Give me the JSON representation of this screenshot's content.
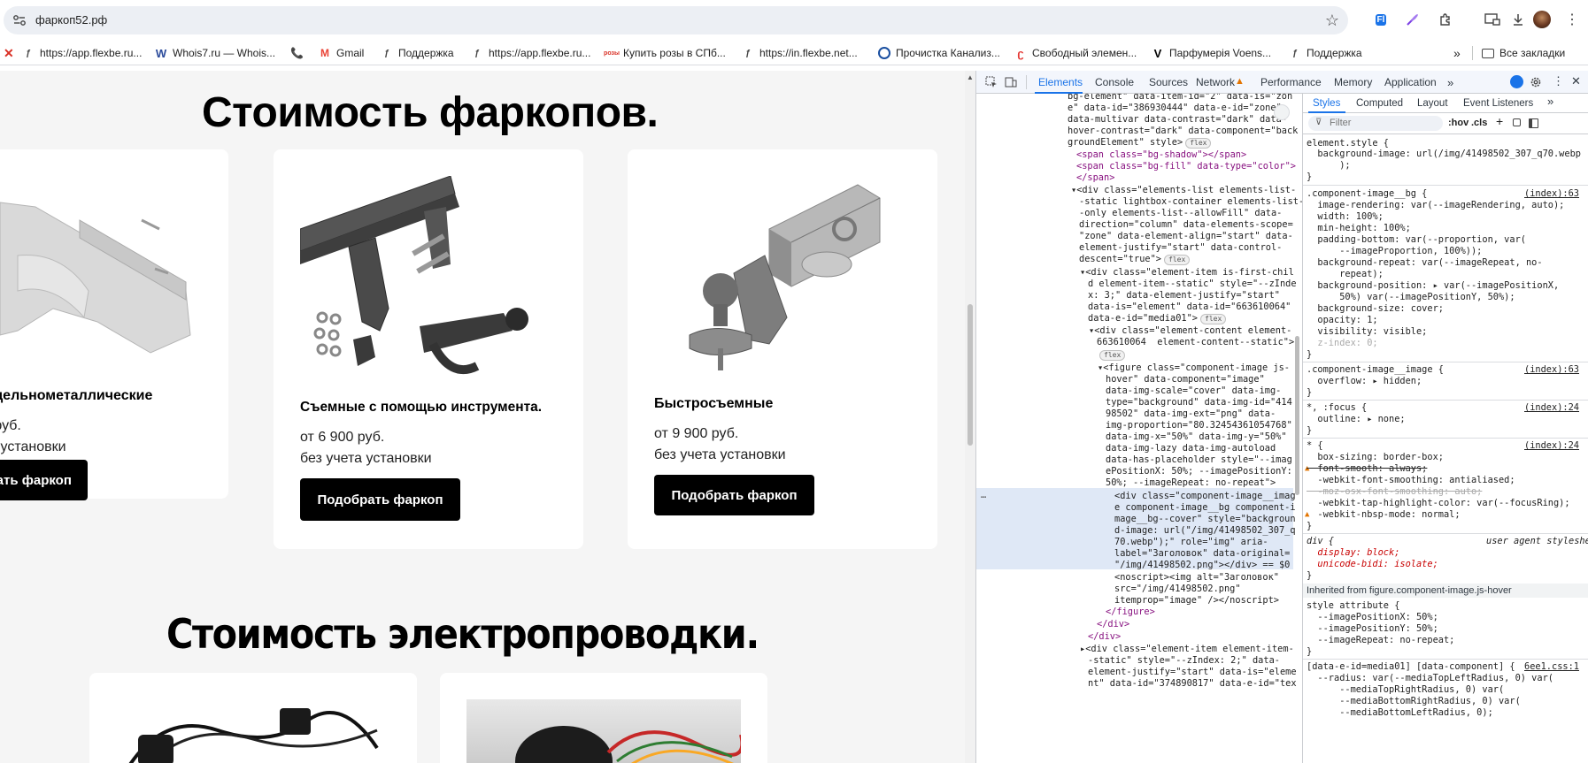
{
  "browser": {
    "url": "фаркоп52.рф",
    "bookmarks": [
      "https://app.flexbe.ru...",
      "Whois7.ru — Whois...",
      "Gmail",
      "Поддержка",
      "https://app.flexbe.ru...",
      "Купить розы в СПб...",
      "https://in.flexbe.net...",
      "Прочистка Канализ...",
      "Свободный элемен...",
      "Парфумерія Voens...",
      "Поддержка"
    ],
    "all_bookmarks": "Все закладки",
    "more": "»"
  },
  "page": {
    "heading1": "Стоимость фаркопов.",
    "heading2": "Стоимость электропроводки.",
    "cards": [
      {
        "title": "е цельнометаллические",
        "price": "о руб.",
        "note": "та установки",
        "button": "обрать фаркоп"
      },
      {
        "title": "Съемные с помощью инструмента.",
        "price": "от 6 900 руб.",
        "note": "без учета установки",
        "button": "Подобрать фаркоп"
      },
      {
        "title": "Быстросъемные",
        "price": "от 9 900 руб.",
        "note": "без учета установки",
        "button": "Подобрать фаркоп"
      }
    ]
  },
  "devtools": {
    "tabs": [
      "Elements",
      "Console",
      "Sources",
      "Network",
      "Performance",
      "Memory",
      "Application"
    ],
    "styles_tabs": [
      "Styles",
      "Computed",
      "Layout",
      "Event Listeners"
    ],
    "filter_placeholder": "Filter",
    "filter_buttons": [
      ":hov",
      ".cls"
    ],
    "elements_lines": [
      "bg-element\" data-item-id=\"2\" data-is=\"zon",
      "e\" data-id=\"386930444\" data-e-id=\"zone\"",
      "data-multivar data-contrast=\"dark\" data-",
      "hover-contrast=\"dark\" data-component=\"back",
      "groundElement\" style>",
      "<span class=\"bg-shadow\"></span>",
      "<span class=\"bg-fill\" data-type=\"color\">",
      "</span>",
      "▾<div class=\"elements-list elements-list-",
      "-static lightbox-container elements-list-",
      "-only elements-list--allowFill\" data-",
      "direction=\"column\" data-elements-scope=",
      "\"zone\" data-element-align=\"start\" data-",
      "element-justify=\"start\" data-control-",
      "descent=\"true\">",
      "▾<div class=\"element-item is-first-chil",
      "d element-item--static\" style=\"--zInde",
      "x: 3;\" data-element-justify=\"start\"",
      "data-is=\"element\" data-id=\"663610064\"",
      "data-e-id=\"media01\">",
      "▾<div class=\"element-content element-",
      "663610064  element-content--static\">",
      "",
      "▾<figure class=\"component-image js-",
      "hover\" data-component=\"image\"",
      "data-img-scale=\"cover\" data-img-",
      "type=\"background\" data-img-id=\"414",
      "98502\" data-img-ext=\"png\" data-",
      "img-proportion=\"80.32454361054768\"",
      "data-img-x=\"50%\" data-img-y=\"50%\"",
      "data-img-lazy data-img-autoload",
      "data-has-placeholder style=\"--imag",
      "ePositionX: 50%; --imagePositionY:",
      "50%; --imageRepeat: no-repeat\">",
      "<div class=\"component-image__imag",
      "e component-image__bg component-i",
      "mage__bg--cover\" style=\"backgroun",
      "d-image: url(\"/img/41498502_307_q",
      "70.webp\");\" role=\"img\" aria-",
      "label=\"Заголовок\" data-original=",
      "\"/img/41498502.png\"></div> == $0",
      "<noscript><img alt=\"Заголовок\"",
      "src=\"/img/41498502.png\"",
      "itemprop=\"image\" /></noscript>",
      "</figure>",
      "</div>",
      "</div>",
      "▸<div class=\"element-item element-item-",
      "-static\" style=\"--zIndex: 2;\" data-",
      "element-justify=\"start\" data-is=\"eleme",
      "nt\" data-id=\"374890817\" data-e-id=\"tex"
    ],
    "badges": [
      "flex",
      "flex",
      "flex",
      "flex"
    ],
    "styles_lines": [
      "element.style {",
      "  background-image: url(/img/41498502_307_q70.webp",
      "      );",
      "}",
      ".component-image__bg {",
      "  image-rendering: var(--imageRendering, auto);",
      "  width: 100%;",
      "  min-height: 100%;",
      "  padding-bottom: var(--proportion, var(",
      "      --imageProportion, 100%));",
      "  background-repeat: var(--imageRepeat, no-",
      "      repeat);",
      "  background-position: ▸ var(--imagePositionX,",
      "      50%) var(--imagePositionY, 50%);",
      "  background-size: cover;",
      "  opacity: 1;",
      "  visibility: visible;",
      "  z-index: 0;",
      "}",
      ".component-image__image {",
      "  overflow: ▸ hidden;",
      "}",
      "*, :focus {",
      "  outline: ▸ none;",
      "}",
      "* {",
      "  box-sizing: border-box;",
      "  font-smooth: always;",
      "  -webkit-font-smoothing: antialiased;",
      "  -moz-osx-font-smoothing: auto;",
      "  -webkit-tap-highlight-color: var(--focusRing);",
      "  -webkit-nbsp-mode: normal;",
      "}",
      "div {",
      "  display: block;",
      "  unicode-bidi: isolate;",
      "}",
      "Inherited from figure.component-image.js-hover",
      "style attribute {",
      "  --imagePositionX: 50%;",
      "  --imagePositionY: 50%;",
      "  --imageRepeat: no-repeat;",
      "}",
      "[data-e-id=media01] [data-component] {",
      "  --radius: var(--mediaTopLeftRadius, 0) var(",
      "      --mediaTopRightRadius, 0) var(",
      "      --mediaBottomRightRadius, 0) var(",
      "      --mediaBottomLeftRadius, 0);"
    ],
    "sources": [
      "(index):63",
      "(index):63",
      "(index):24",
      "(index):24",
      "user agent stylesheet",
      "6ee1.css:1"
    ],
    "ellipsis": "…"
  }
}
